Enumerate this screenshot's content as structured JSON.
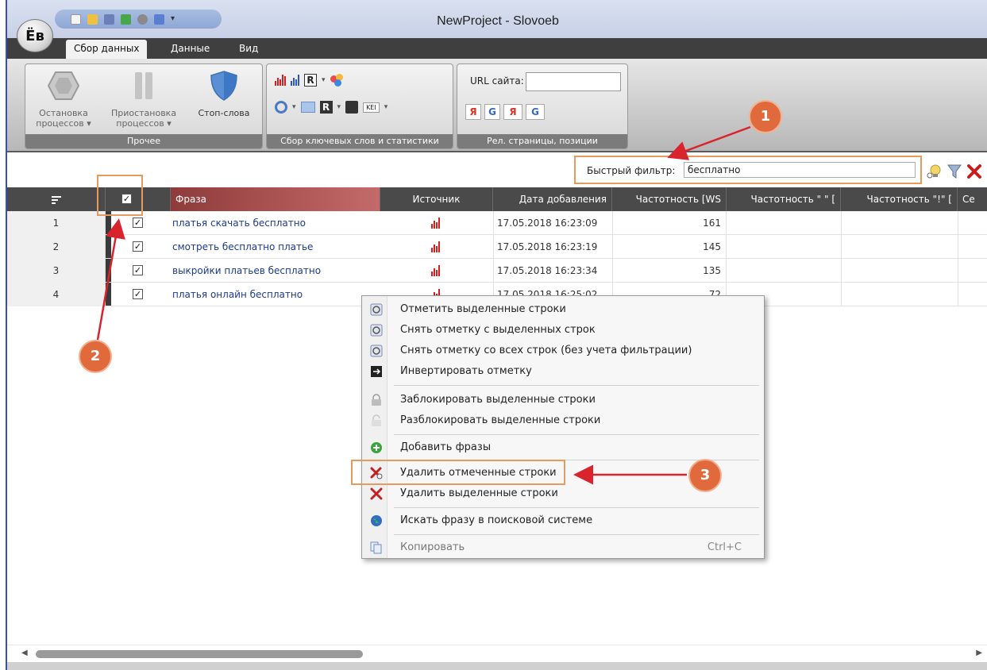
{
  "window": {
    "title": "NewProject - Slovoeb",
    "logo_text": "Ёв"
  },
  "tabs": [
    {
      "label": "Сбор данных"
    },
    {
      "label": "Данные"
    },
    {
      "label": "Вид"
    }
  ],
  "ribbon": {
    "groups": [
      {
        "caption": "Прочее",
        "buttons": [
          {
            "label": "Остановка процессов ▾",
            "icon": "hexagon-stop-icon"
          },
          {
            "label": "Приостановка процессов ▾",
            "icon": "pause-icon"
          },
          {
            "label": "Стоп-слова",
            "icon": "shield-icon"
          }
        ]
      },
      {
        "caption": "Сбор ключевых слов и статистики",
        "kei_label": "KEI"
      },
      {
        "caption": "Рел. страницы, позиции",
        "url_label": "URL сайта:",
        "url_value": ""
      }
    ]
  },
  "filter": {
    "label": "Быстрый фильтр:",
    "value": "бесплатно"
  },
  "columns": [
    {
      "label": ""
    },
    {
      "label": ""
    },
    {
      "label": "Фраза"
    },
    {
      "label": "Источник"
    },
    {
      "label": "Дата добавления"
    },
    {
      "label": "Частотность [WS"
    },
    {
      "label": "Частотность \" \" ["
    },
    {
      "label": "Частотность \"!\" ["
    },
    {
      "label": "Се"
    }
  ],
  "rows": [
    {
      "num": "1",
      "checked": "✓",
      "phrase": "платья скачать бесплатно",
      "date": "17.05.2018 16:23:09",
      "freq": "161"
    },
    {
      "num": "2",
      "checked": "✓",
      "phrase": "смотреть бесплатно платье",
      "date": "17.05.2018 16:23:19",
      "freq": "145"
    },
    {
      "num": "3",
      "checked": "✓",
      "phrase": "выкройки платьев бесплатно",
      "date": "17.05.2018 16:23:34",
      "freq": "135"
    },
    {
      "num": "4",
      "checked": "✓",
      "phrase": "платья онлайн бесплатно",
      "date": "17.05.2018 16:25:02",
      "freq": "72"
    }
  ],
  "header_checkbox": "✓",
  "context_menu": {
    "items": [
      {
        "label": "Отметить выделенные строки",
        "icon": "check-badge-icon"
      },
      {
        "label": "Снять отметку с выделенных строк",
        "icon": "check-badge-icon"
      },
      {
        "label": "Снять отметку со всех строк (без учета фильтрации)",
        "icon": "check-badge-icon"
      },
      {
        "label": "Инвертировать отметку",
        "icon": "invert-icon"
      },
      {
        "label": "Заблокировать выделенные строки",
        "icon": "lock-icon"
      },
      {
        "label": "Разблокировать выделенные строки",
        "icon": "unlock-icon"
      },
      {
        "label": "Добавить фразы",
        "icon": "add-icon"
      },
      {
        "label": "Удалить отмеченные строки",
        "icon": "delete-checked-icon"
      },
      {
        "label": "Удалить выделенные строки",
        "icon": "delete-icon"
      },
      {
        "label": "Искать фразу в поисковой системе",
        "icon": "globe-icon"
      },
      {
        "label": "Копировать",
        "icon": "copy-icon",
        "shortcut": "Ctrl+C"
      }
    ]
  },
  "annotations": [
    {
      "label": "1"
    },
    {
      "label": "2"
    },
    {
      "label": "3"
    }
  ],
  "colors": {
    "annotation": "#e06a3b",
    "annotation_box": "#e59a5e",
    "arrow": "#d9232d",
    "phrase_text": "#1d3a8c",
    "header_bg": "#4a4a4a"
  }
}
